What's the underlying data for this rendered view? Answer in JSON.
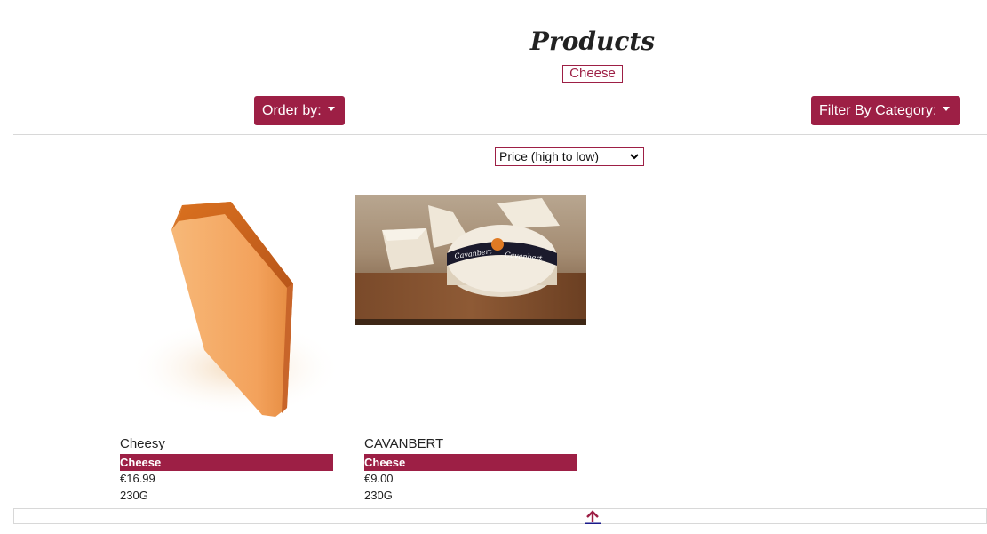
{
  "header": {
    "title": "Products",
    "active_category": "Cheese"
  },
  "toolbar": {
    "order_label": "Order by:",
    "filter_label": "Filter By Category:"
  },
  "sort": {
    "selected": "Price (high to low)"
  },
  "products": [
    {
      "name": "Cheesy",
      "category": "Cheese",
      "price": "€16.99",
      "weight": "230G"
    },
    {
      "name": "CAVANBERT",
      "category": "Cheese",
      "price": "€9.00",
      "weight": "230G"
    }
  ],
  "image_labels": {
    "band_text_1": "Cavanbert",
    "band_text_2": "Cavanbert"
  },
  "colors": {
    "brand": "#9d1f45",
    "divider": "#d8d8d8"
  },
  "icons": {
    "caret": "caret-down-icon",
    "back_to_top": "arrow-up-icon"
  }
}
